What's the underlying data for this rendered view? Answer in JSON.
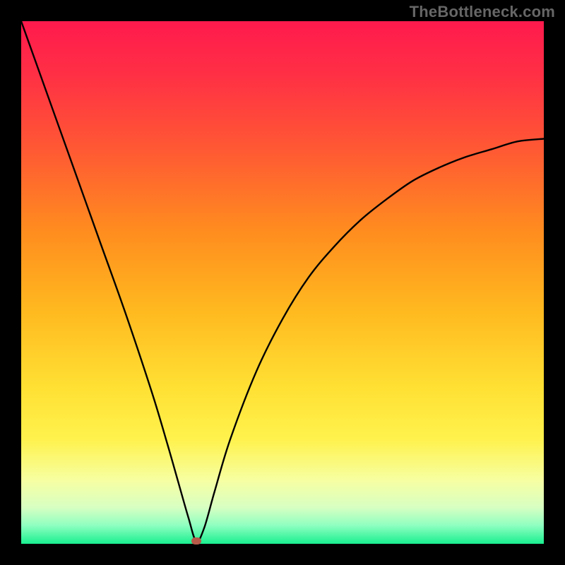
{
  "watermark": "TheBottleneck.com",
  "colors": {
    "frame": "#000000",
    "curve": "#000000",
    "marker": "#b85a4a",
    "gradient_stops": [
      {
        "offset": 0.0,
        "color": "#ff1a4d"
      },
      {
        "offset": 0.1,
        "color": "#ff2f45"
      },
      {
        "offset": 0.25,
        "color": "#ff5a33"
      },
      {
        "offset": 0.4,
        "color": "#ff8c1f"
      },
      {
        "offset": 0.55,
        "color": "#ffb81f"
      },
      {
        "offset": 0.7,
        "color": "#ffe033"
      },
      {
        "offset": 0.8,
        "color": "#fff24d"
      },
      {
        "offset": 0.88,
        "color": "#f6ffa3"
      },
      {
        "offset": 0.93,
        "color": "#d8ffc2"
      },
      {
        "offset": 0.965,
        "color": "#8effc0"
      },
      {
        "offset": 1.0,
        "color": "#19ef8f"
      }
    ]
  },
  "chart_data": {
    "type": "line",
    "title": "",
    "xlabel": "",
    "ylabel": "",
    "xlim": [
      0,
      100
    ],
    "ylim": [
      0,
      100
    ],
    "grid": false,
    "legend": false,
    "series": [
      {
        "name": "curve",
        "x": [
          0,
          5,
          10,
          15,
          20,
          25,
          28,
          30,
          32,
          33.5,
          35,
          37,
          40,
          45,
          50,
          55,
          60,
          65,
          70,
          75,
          80,
          85,
          90,
          95,
          100
        ],
        "y": [
          100,
          86,
          72,
          58,
          44,
          29,
          19,
          12,
          5,
          0.5,
          3,
          10,
          20,
          33,
          43,
          51,
          57,
          62,
          66,
          69.5,
          72,
          74,
          75.5,
          77,
          77.5
        ]
      }
    ],
    "marker": {
      "x": 33.5,
      "y": 0.5
    }
  }
}
